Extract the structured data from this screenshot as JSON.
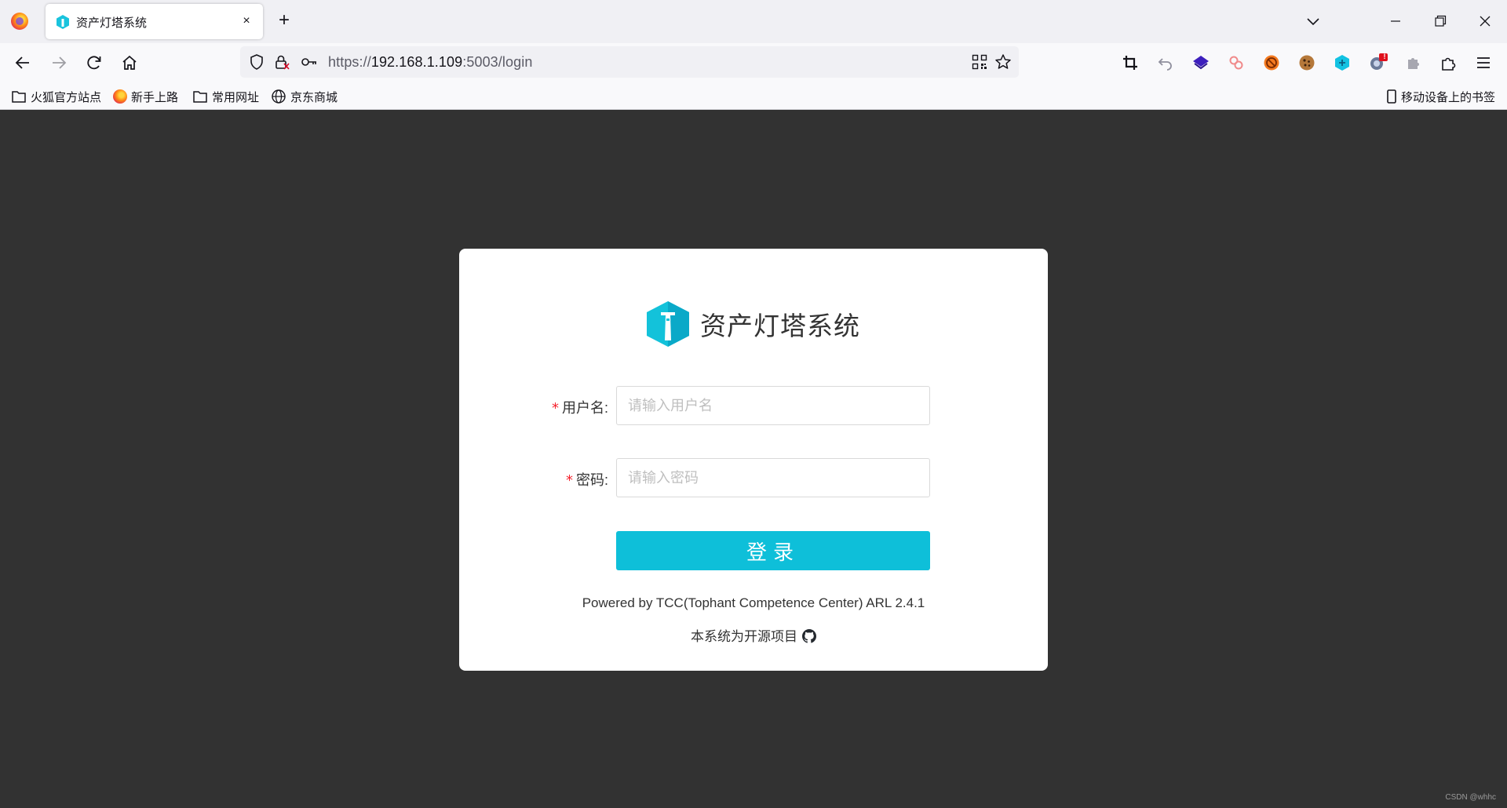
{
  "browser": {
    "tab": {
      "title": "资产灯塔系统",
      "close": "×"
    },
    "new_tab": "+",
    "url": {
      "scheme": "https://",
      "host": "192.168.1.109",
      "rest": ":5003/login"
    },
    "icons": [
      "firefox-logo",
      "tab-list-chevron",
      "minimize",
      "restore",
      "close",
      "back-arrow",
      "forward-arrow",
      "reload",
      "home",
      "tracking-shield",
      "lock",
      "key",
      "qr-code",
      "star",
      "crop",
      "undo",
      "layers-extension",
      "link-extension",
      "blocked-extension",
      "cookie-extension",
      "cube-extension",
      "globe-extension",
      "puzzle-extension",
      "extensions",
      "hamburger-menu",
      "github"
    ],
    "extension_badge": "!"
  },
  "bookmarks": {
    "items": [
      {
        "label": "火狐官方站点"
      },
      {
        "label": "新手上路"
      },
      {
        "label": "常用网址"
      },
      {
        "label": "京东商城"
      }
    ],
    "mobile": "移动设备上的书签"
  },
  "login": {
    "app_name": "资产灯塔系统",
    "username_label": "用户名",
    "username_placeholder": "请输入用户名",
    "username_value": "",
    "password_label": "密码",
    "password_placeholder": "请输入密码",
    "password_value": "",
    "required_mark": "*",
    "colon": ":",
    "submit_label": "登录",
    "powered_by": "Powered by TCC(Tophant Competence Center) ARL 2.4.1",
    "open_source": "本系统为开源项目"
  },
  "colors": {
    "accent": "#0ebfd9",
    "page_bg": "#323232",
    "required": "#f5222d"
  },
  "watermark": "CSDN @whhc"
}
